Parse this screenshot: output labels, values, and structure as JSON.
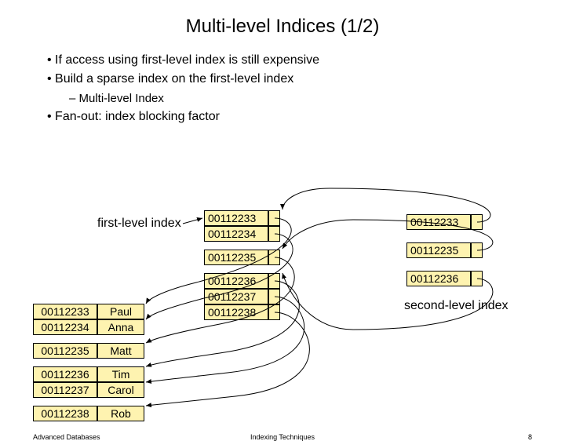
{
  "title": "Multi-level Indices (1/2)",
  "bullets": {
    "b1": "If access using first-level index is still expensive",
    "b2": "Build a sparse index on the first-level index",
    "b2a": "Multi-level Index",
    "b3": "Fan-out: index blocking factor"
  },
  "labels": {
    "first": "first-level index",
    "second": "second-level index"
  },
  "first_level": [
    {
      "key": "00112233"
    },
    {
      "key": "00112234"
    },
    {
      "key": "00112235"
    },
    {
      "key": "00112236"
    },
    {
      "key": "00112237"
    },
    {
      "key": "00112238"
    }
  ],
  "second_level": [
    {
      "key": "00112233"
    },
    {
      "key": "00112235"
    },
    {
      "key": "00112236"
    }
  ],
  "data_records": [
    {
      "key": "00112233",
      "name": "Paul"
    },
    {
      "key": "00112234",
      "name": "Anna"
    },
    {
      "key": "00112235",
      "name": "Matt"
    },
    {
      "key": "00112236",
      "name": "Tim"
    },
    {
      "key": "00112237",
      "name": "Carol"
    },
    {
      "key": "00112238",
      "name": "Rob"
    }
  ],
  "footer": {
    "left": "Advanced Databases",
    "mid": "Indexing Techniques",
    "right": "8"
  },
  "chart_data": {
    "type": "table",
    "description": "Multi-level index diagram",
    "data_records": [
      [
        "00112233",
        "Paul"
      ],
      [
        "00112234",
        "Anna"
      ],
      [
        "00112235",
        "Matt"
      ],
      [
        "00112236",
        "Tim"
      ],
      [
        "00112237",
        "Carol"
      ],
      [
        "00112238",
        "Rob"
      ]
    ],
    "first_level_index": [
      "00112233",
      "00112234",
      "00112235",
      "00112236",
      "00112237",
      "00112238"
    ],
    "second_level_index": [
      "00112233",
      "00112235",
      "00112236"
    ],
    "first_level_blocks": [
      [
        "00112233",
        "00112234"
      ],
      [
        "00112235"
      ],
      [
        "00112236",
        "00112237",
        "00112238"
      ]
    ],
    "pointers": {
      "second_to_first": {
        "00112233": "00112233",
        "00112235": "00112235",
        "00112236": "00112236"
      },
      "first_to_data": {
        "00112233": "00112233",
        "00112234": "00112234",
        "00112235": "00112235",
        "00112236": "00112236",
        "00112237": "00112237",
        "00112238": "00112238"
      }
    }
  }
}
